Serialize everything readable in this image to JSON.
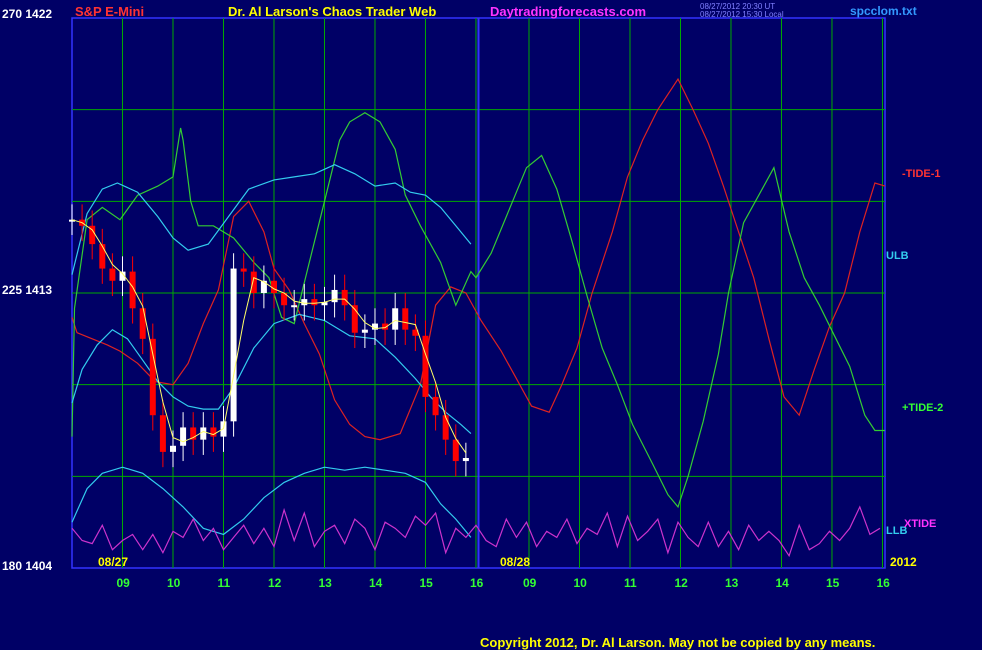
{
  "header": {
    "symbol": "S&P E-Mini",
    "title": "Dr. Al Larson's Chaos Trader Web",
    "site": "Daytradingforecasts.com",
    "stamp_ut": "08/27/2012 20:30 UT",
    "stamp_local": "08/27/2012 15:30 Local",
    "file": "spcclom.txt"
  },
  "y_axis": {
    "top": "270  1422",
    "mid": "225  1413",
    "bottom": "180  1404"
  },
  "dates": {
    "start": "08/27",
    "second": "08/28",
    "year": "2012"
  },
  "right_labels": {
    "tide1": "-TIDE-1",
    "ulb": "ULB",
    "tide2": "+TIDE-2",
    "llb": "LLB",
    "xtide": "XTIDE"
  },
  "footer": {
    "copyright": "Copyright 2012, Dr. Al Larson. May not be copied by any means."
  },
  "colors": {
    "background": "#000066",
    "grid": "#00aa00",
    "divider": "#3333ff",
    "tide1": "#dd2222",
    "tide2": "#33cc33",
    "bands": "#33ccee",
    "xtide": "#cc33cc",
    "price_up": "#ffffff",
    "price_down": "#ff0000",
    "average": "#ffff66"
  },
  "chart_data": {
    "type": "line",
    "title": "Dr. Al Larson's Chaos Trader Web",
    "x_tick_labels": [
      "09",
      "10",
      "11",
      "12",
      "13",
      "14",
      "15",
      "16",
      "09",
      "10",
      "11",
      "12",
      "13",
      "14",
      "15",
      "16"
    ],
    "y_left_ticks": [
      {
        "scale": 270,
        "price": 1422
      },
      {
        "scale": 225,
        "price": 1413
      },
      {
        "scale": 180,
        "price": 1404
      }
    ],
    "ylim": [
      1404,
      1422
    ],
    "grid": true,
    "series": [
      {
        "name": "-TIDE-1",
        "x": [
          0,
          0.1,
          0.4,
          0.7,
          0.95,
          1.3,
          1.65,
          2.0,
          2.3,
          2.6,
          2.9,
          3.2,
          3.5,
          3.8,
          4.0,
          4.3,
          4.6,
          4.9,
          5.2,
          5.5,
          5.8,
          6.1,
          6.5,
          6.9,
          7.2,
          7.5,
          7.8,
          8.1,
          8.5,
          8.8,
          9.1,
          9.45,
          9.7,
          10.0,
          10.3,
          10.7,
          11.0,
          11.3,
          11.6,
          12.0,
          12.3,
          12.6,
          12.9,
          13.2,
          13.5,
          13.8,
          14.1,
          14.4,
          14.7,
          15.0,
          15.3,
          15.6,
          15.9,
          16.1
        ],
        "values": [
          1412.2,
          1411.7,
          1411.5,
          1411.3,
          1411.1,
          1410.7,
          1410.1,
          1410.0,
          1410.7,
          1412.0,
          1413.1,
          1415.5,
          1416.0,
          1415.0,
          1413.8,
          1413.1,
          1412.0,
          1411.0,
          1409.5,
          1408.7,
          1408.3,
          1408.2,
          1408.4,
          1410.0,
          1412.6,
          1413.2,
          1413.0,
          1412.1,
          1411.1,
          1410.2,
          1409.3,
          1409.1,
          1410.0,
          1411.2,
          1413.0,
          1415.0,
          1416.8,
          1418.0,
          1419.0,
          1420.0,
          1419.0,
          1417.9,
          1416.5,
          1415.0,
          1413.5,
          1411.5,
          1409.6,
          1409.0,
          1410.5,
          1411.9,
          1413.0,
          1415.0,
          1416.6,
          1416.5
        ]
      },
      {
        "name": "+TIDE-2",
        "x": [
          0,
          0.05,
          0.3,
          0.6,
          0.95,
          1.3,
          1.7,
          2.0,
          2.15,
          2.2,
          2.35,
          2.5,
          2.8,
          3.2,
          3.6,
          3.9,
          4.15,
          4.4,
          4.7,
          5.0,
          5.3,
          5.5,
          5.8,
          6.1,
          6.4,
          6.6,
          6.9,
          7.3,
          7.6,
          7.9,
          8.0,
          8.3,
          8.6,
          9.0,
          9.3,
          9.6,
          9.9,
          10.2,
          10.5,
          10.8,
          11.1,
          11.5,
          11.8,
          12.0,
          12.2,
          12.5,
          12.8,
          13.0,
          13.3,
          13.6,
          13.9,
          14.2,
          14.5,
          14.8,
          15.1,
          15.4,
          15.7,
          15.9,
          16.1
        ],
        "values": [
          1408.3,
          1412.5,
          1415.4,
          1415.8,
          1415.4,
          1416.2,
          1416.5,
          1416.8,
          1418.4,
          1418.0,
          1416.0,
          1415.2,
          1415.2,
          1414.8,
          1414.0,
          1413.5,
          1412.2,
          1412.0,
          1414.0,
          1416.0,
          1418.0,
          1418.6,
          1418.9,
          1418.6,
          1417.7,
          1416.2,
          1415.2,
          1414.0,
          1412.6,
          1413.7,
          1413.5,
          1414.3,
          1415.5,
          1417.1,
          1417.5,
          1416.4,
          1414.7,
          1412.9,
          1411.2,
          1410.0,
          1408.7,
          1407.4,
          1406.4,
          1406.0,
          1407.0,
          1408.8,
          1411.0,
          1413.0,
          1415.3,
          1416.2,
          1417.1,
          1415.0,
          1413.5,
          1412.6,
          1411.6,
          1410.6,
          1409.0,
          1408.5,
          1408.5
        ]
      },
      {
        "name": "ULB",
        "x": [
          0,
          0.3,
          0.6,
          0.9,
          1.3,
          1.7,
          2.0,
          2.3,
          2.7,
          3.1,
          3.5,
          4.0,
          4.4,
          4.8,
          5.2,
          5.6,
          6.0,
          6.4,
          6.7,
          7.0,
          7.3,
          7.6,
          7.9
        ],
        "values": [
          1413.6,
          1415.6,
          1416.4,
          1416.6,
          1416.3,
          1415.5,
          1414.8,
          1414.4,
          1414.6,
          1415.5,
          1416.4,
          1416.7,
          1416.8,
          1416.9,
          1417.2,
          1416.9,
          1416.5,
          1416.6,
          1416.3,
          1416.2,
          1415.8,
          1415.2,
          1414.6
        ]
      },
      {
        "name": "LLB",
        "x": [
          0,
          0.2,
          0.5,
          0.8,
          1.1,
          1.4,
          1.7,
          2.0,
          2.3,
          2.6,
          2.9,
          3.2,
          3.6,
          4.0,
          4.5,
          5.0,
          5.5,
          6.0,
          6.4,
          6.8,
          7.1,
          7.4,
          7.7,
          7.9
        ],
        "values": [
          1409.4,
          1410.5,
          1411.3,
          1411.8,
          1411.5,
          1410.8,
          1410.1,
          1409.6,
          1409.3,
          1409.2,
          1409.2,
          1409.9,
          1411.2,
          1412.0,
          1412.3,
          1412.1,
          1411.6,
          1411.5,
          1410.9,
          1410.2,
          1409.6,
          1409.1,
          1408.7,
          1408.4
        ]
      },
      {
        "name": "ULB lower band",
        "x": [
          0,
          0.3,
          0.6,
          1.0,
          1.4,
          1.8,
          2.2,
          2.6,
          3.0,
          3.4,
          3.8,
          4.2,
          4.6,
          5.0,
          5.4,
          5.8,
          6.2,
          6.6,
          7.0,
          7.3,
          7.6,
          7.9
        ],
        "values": [
          1405.5,
          1406.6,
          1407.1,
          1407.3,
          1407.1,
          1406.6,
          1406.0,
          1405.3,
          1405.1,
          1405.6,
          1406.3,
          1406.8,
          1407.1,
          1407.3,
          1407.2,
          1407.3,
          1407.2,
          1407.1,
          1406.8,
          1406.1,
          1405.6,
          1405.0
        ]
      },
      {
        "name": "XTIDE",
        "x": [
          0,
          0.2,
          0.4,
          0.6,
          0.8,
          1.0,
          1.2,
          1.4,
          1.6,
          1.8,
          2.0,
          2.2,
          2.4,
          2.6,
          2.8,
          3.0,
          3.2,
          3.4,
          3.6,
          3.8,
          4.0,
          4.2,
          4.4,
          4.6,
          4.8,
          5.0,
          5.2,
          5.4,
          5.6,
          5.8,
          6.0,
          6.2,
          6.4,
          6.6,
          6.8,
          7.0,
          7.2,
          7.4,
          7.6,
          7.8,
          8.0,
          8.2,
          8.4,
          8.6,
          8.8,
          9.0,
          9.2,
          9.4,
          9.6,
          9.8,
          10.0,
          10.2,
          10.4,
          10.6,
          10.8,
          11.0,
          11.2,
          11.4,
          11.6,
          11.8,
          12.0,
          12.2,
          12.4,
          12.6,
          12.8,
          13.0,
          13.2,
          13.4,
          13.6,
          13.8,
          14.0,
          14.2,
          14.4,
          14.6,
          14.8,
          15.0,
          15.2,
          15.4,
          15.6,
          15.8,
          16.0
        ],
        "values": [
          1405.3,
          1404.9,
          1404.8,
          1405.4,
          1404.6,
          1404.9,
          1405.1,
          1404.6,
          1405.1,
          1404.5,
          1405.2,
          1405.0,
          1405.6,
          1404.9,
          1405.3,
          1404.6,
          1405.0,
          1405.4,
          1404.8,
          1405.3,
          1404.7,
          1405.9,
          1404.9,
          1405.8,
          1404.7,
          1405.2,
          1405.4,
          1404.8,
          1405.6,
          1405.3,
          1404.6,
          1405.5,
          1405.3,
          1405.0,
          1405.7,
          1405.4,
          1405.8,
          1404.5,
          1405.3,
          1405.0,
          1405.4,
          1404.9,
          1404.7,
          1405.6,
          1405.0,
          1405.5,
          1404.7,
          1405.2,
          1405.0,
          1405.6,
          1404.8,
          1405.3,
          1405.1,
          1405.8,
          1404.7,
          1405.7,
          1404.9,
          1405.2,
          1405.6,
          1404.5,
          1405.5,
          1405.0,
          1404.7,
          1405.5,
          1404.7,
          1405.2,
          1404.6,
          1405.4,
          1404.9,
          1405.2,
          1404.9,
          1404.4,
          1405.4,
          1404.6,
          1404.8,
          1405.2,
          1404.9,
          1405.3,
          1406.0,
          1405.1,
          1405.3
        ]
      },
      {
        "name": "Price",
        "x": [
          0,
          0.2,
          0.4,
          0.6,
          0.8,
          1.0,
          1.2,
          1.4,
          1.6,
          1.8,
          2.0,
          2.2,
          2.4,
          2.6,
          2.8,
          3.0,
          3.2,
          3.4,
          3.6,
          3.8,
          4.0,
          4.2,
          4.4,
          4.6,
          4.8,
          5.0,
          5.2,
          5.4,
          5.6,
          5.8,
          6.0,
          6.2,
          6.4,
          6.6,
          6.8,
          7.0,
          7.2,
          7.4,
          7.6,
          7.8
        ],
        "values": [
          1415.4,
          1415.2,
          1414.6,
          1413.8,
          1413.4,
          1413.7,
          1412.5,
          1411.5,
          1409.0,
          1407.8,
          1408.0,
          1408.6,
          1408.2,
          1408.6,
          1408.3,
          1408.8,
          1413.8,
          1413.7,
          1413.0,
          1413.4,
          1413.0,
          1412.6,
          1412.6,
          1412.8,
          1412.6,
          1412.7,
          1413.1,
          1412.6,
          1411.7,
          1411.8,
          1412.0,
          1411.8,
          1412.5,
          1411.8,
          1411.6,
          1409.6,
          1409.0,
          1408.2,
          1407.5,
          1407.6
        ]
      }
    ]
  }
}
